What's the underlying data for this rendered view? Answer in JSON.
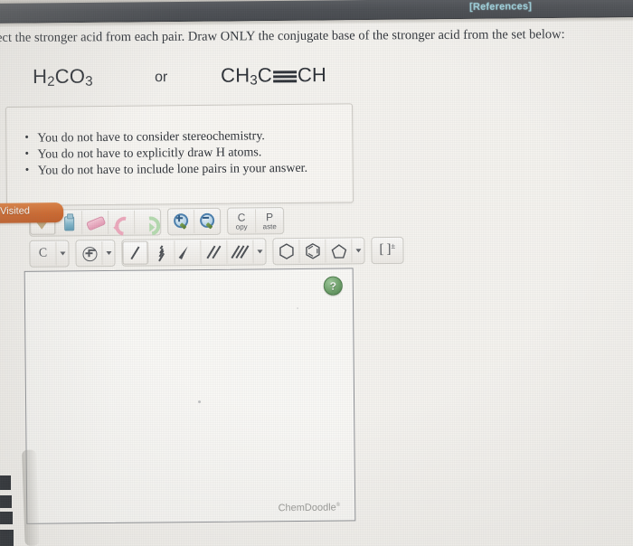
{
  "topbar": {
    "references_label": "[References]",
    "bar_color": "#4a4d52",
    "link_color": "#9fd2dd"
  },
  "question": {
    "text": "lect the stronger acid from each pair. Draw ONLY the conjugate base of the stronger acid from the set below:"
  },
  "formulas": {
    "left": {
      "part1": "H",
      "sub1": "2",
      "part2": "CO",
      "sub2": "3"
    },
    "connector": "or",
    "right": {
      "part1": "CH",
      "sub1": "3",
      "part2": "C",
      "bond": "triple-bond",
      "part3": "CH"
    }
  },
  "notes": {
    "items": [
      "You do not have to consider stereochemistry.",
      "You do not have to explicitly draw H atoms.",
      "You do not have to include lone pairs in your answer."
    ]
  },
  "visited_badge": {
    "label": "Visited",
    "color": "#cf6326"
  },
  "toolbar": {
    "row1": [
      {
        "name": "select-tool",
        "icon": "select-arrow-icon",
        "selected": true
      },
      {
        "name": "clear-tool",
        "icon": "clear-spray-icon",
        "selected": false
      },
      {
        "name": "eraser-tool",
        "icon": "eraser-icon",
        "selected": false
      },
      {
        "name": "undo-button",
        "icon": "undo-arrow-icon",
        "selected": false
      },
      {
        "name": "redo-button",
        "icon": "redo-arrow-icon",
        "selected": false
      },
      {
        "name": "zoom-in-button",
        "icon": "magnifier-plus-icon",
        "selected": false
      },
      {
        "name": "zoom-out-button",
        "icon": "magnifier-minus-icon",
        "selected": false
      },
      {
        "name": "copy-button",
        "icon": "copy-icon",
        "label_big": "C",
        "label_small": "opy"
      },
      {
        "name": "paste-button",
        "icon": "paste-icon",
        "label_big": "P",
        "label_small": "aste"
      }
    ],
    "row2": [
      {
        "name": "element-carbon-tool",
        "label": "C",
        "has_caret": true
      },
      {
        "name": "charge-tool",
        "icon": "charge-circle-icon",
        "has_caret": true
      },
      {
        "name": "single-bond-tool",
        "icon": "single-bond-icon",
        "selected": true
      },
      {
        "name": "hash-bond-tool",
        "icon": "hash-bond-icon",
        "selected": false
      },
      {
        "name": "wedge-bond-tool",
        "icon": "wedge-bond-icon",
        "selected": false
      },
      {
        "name": "double-bond-tool",
        "icon": "double-bond-icon",
        "selected": false
      },
      {
        "name": "triple-bond-tool",
        "icon": "triple-bond-icon",
        "selected": false,
        "has_caret": true
      },
      {
        "name": "cyclohexane-ring-tool",
        "icon": "hexagon-ring-icon",
        "selected": false
      },
      {
        "name": "benzene-ring-tool",
        "icon": "benzene-ring-icon",
        "selected": false
      },
      {
        "name": "cyclopentane-ring-tool",
        "icon": "pentagon-ring-icon",
        "selected": false,
        "has_caret": true
      },
      {
        "name": "charge-bracket-tool",
        "icon": "bracket-charge-icon",
        "bracket_left": "[",
        "bracket_right": "]",
        "charge": "±"
      }
    ]
  },
  "canvas": {
    "help_label": "?",
    "watermark": "ChemDoodle",
    "watermark_mark": "®"
  }
}
